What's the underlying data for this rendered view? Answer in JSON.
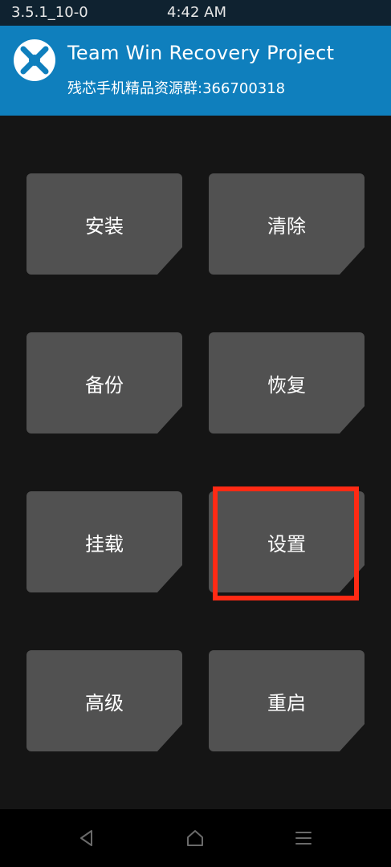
{
  "status_bar": {
    "version": "3.5.1_10-0",
    "time": "4:42 AM"
  },
  "header": {
    "title": "Team Win Recovery Project",
    "subtitle": "残芯手机精品资源群:366700318",
    "logo_icon": "twrp-logo-icon"
  },
  "menu": {
    "install": "安装",
    "wipe": "清除",
    "backup": "备份",
    "restore": "恢复",
    "mount": "挂载",
    "settings": "设置",
    "advanced": "高级",
    "reboot": "重启"
  },
  "nav_bar": {
    "back_icon": "back-triangle-icon",
    "home_icon": "home-icon",
    "menu_icon": "menu-lines-icon"
  },
  "colors": {
    "header_bg": "#0f7fbd",
    "status_bg": "#0f2230",
    "tile_bg": "#515151",
    "highlight": "#ff2a14"
  }
}
